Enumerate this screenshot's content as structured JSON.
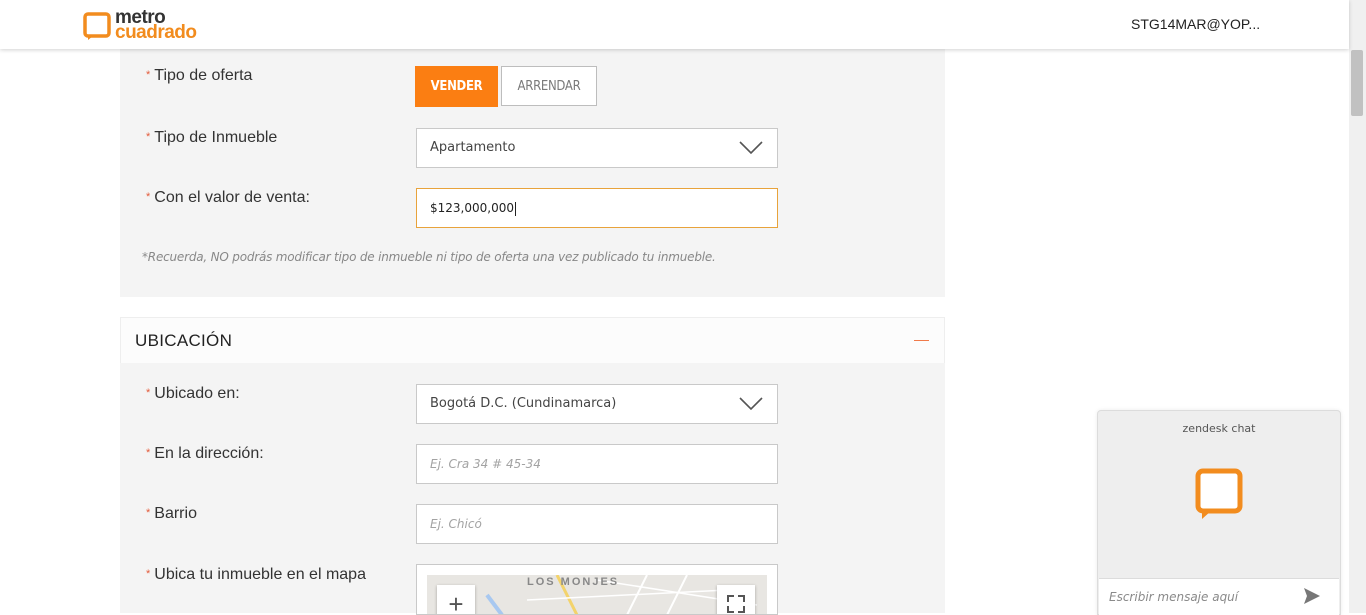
{
  "header": {
    "logo_top": "metro",
    "logo_bottom": "cuadrado",
    "user_email": "STG14MAR@YOP..."
  },
  "offer": {
    "offer_type_label": "Tipo de oferta",
    "sell_button": "VENDER",
    "rent_button": "ARRENDAR",
    "property_type_label": "Tipo de Inmueble",
    "property_type_value": "Apartamento",
    "sale_value_label": "Con el valor de venta:",
    "sale_value": "$123,000,000",
    "note": "*Recuerda, NO podrás modificar tipo de inmueble ni tipo de oferta una vez publicado tu inmueble."
  },
  "location": {
    "section_title": "UBICACIÓN",
    "located_in_label": "Ubicado en:",
    "located_in_value": "Bogotá D.C. (Cundinamarca)",
    "address_label": "En la dirección:",
    "address_placeholder": "Ej. Cra 34 # 45-34",
    "neighborhood_label": "Barrio",
    "neighborhood_placeholder": "Ej. Chicó",
    "map_label": "Ubica tu inmueble en el mapa",
    "map_place_name": "LOS MONJES",
    "zoom_in": "+"
  },
  "required_mark": "*",
  "chat": {
    "title": "zendesk chat",
    "input_placeholder": "Escribir mensaje aquí"
  },
  "colors": {
    "accent": "#fb7e12",
    "brand_orange": "#f28c1e",
    "panel_bg": "#f4f4f4"
  }
}
